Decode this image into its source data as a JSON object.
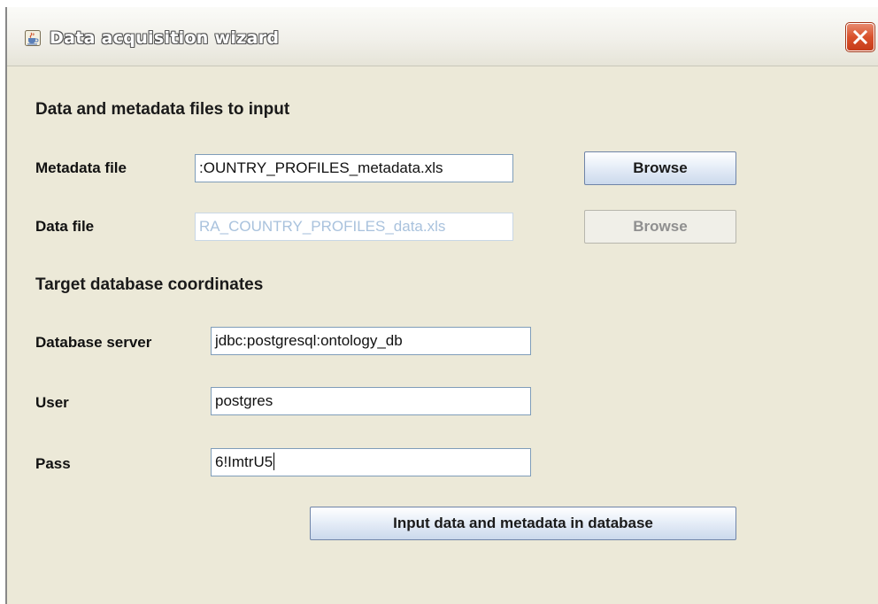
{
  "window": {
    "title": "Data acquisition wizard",
    "icon": "java-cup-icon",
    "close_icon": "close-x-icon"
  },
  "files_section": {
    "heading": "Data and metadata files to input",
    "metadata": {
      "label": "Metadata file",
      "value": ":OUNTRY_PROFILES_metadata.xls",
      "button": "Browse"
    },
    "data": {
      "label": "Data file",
      "value": "RA_COUNTRY_PROFILES_data.xls",
      "button": "Browse"
    }
  },
  "database_section": {
    "heading": "Target database coordinates",
    "server": {
      "label": "Database server",
      "value": "jdbc:postgresql:ontology_db"
    },
    "user": {
      "label": "User",
      "value": "postgres"
    },
    "pass": {
      "label": "Pass",
      "value": "6!ImtrU5"
    }
  },
  "submit_button": "Input data and metadata in database"
}
